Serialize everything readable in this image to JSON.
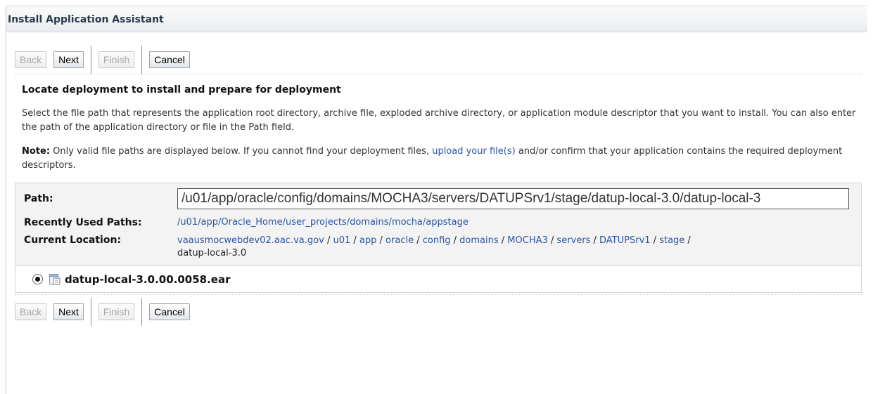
{
  "window": {
    "title": "Install Application Assistant"
  },
  "buttons": {
    "back": "Back",
    "next": "Next",
    "finish": "Finish",
    "cancel": "Cancel"
  },
  "section": {
    "heading": "Locate deployment to install and prepare for deployment",
    "description": "Select the file path that represents the application root directory, archive file, exploded archive directory, or application module descriptor that you want to install. You can also enter the path of the application directory or file in the Path field.",
    "note_label": "Note:",
    "note_before_link": " Only valid file paths are displayed below. If you cannot find your deployment files, ",
    "note_link": "upload your file(s)",
    "note_after_link": " and/or confirm that your application contains the required deployment descriptors."
  },
  "form": {
    "path_label": "Path:",
    "path_value": "/u01/app/oracle/config/domains/MOCHA3/servers/DATUPSrv1/stage/datup-local-3.0/datup-local-3",
    "recent_label": "Recently Used Paths:",
    "recent_value": "/u01/app/Oracle_Home/user_projects/domains/mocha/appstage",
    "current_label": "Current Location:",
    "breadcrumb": [
      "vaausmocwebdev02.aac.va.gov",
      "u01",
      "app",
      "oracle",
      "config",
      "domains",
      "MOCHA3",
      "servers",
      "DATUPSrv1",
      "stage"
    ],
    "breadcrumb_separator": " / ",
    "breadcrumb_current": "datup-local-3.0"
  },
  "files": [
    {
      "name": "datup-local-3.0.00.0058.ear",
      "selected": true,
      "icon": "archive-file-icon"
    }
  ]
}
